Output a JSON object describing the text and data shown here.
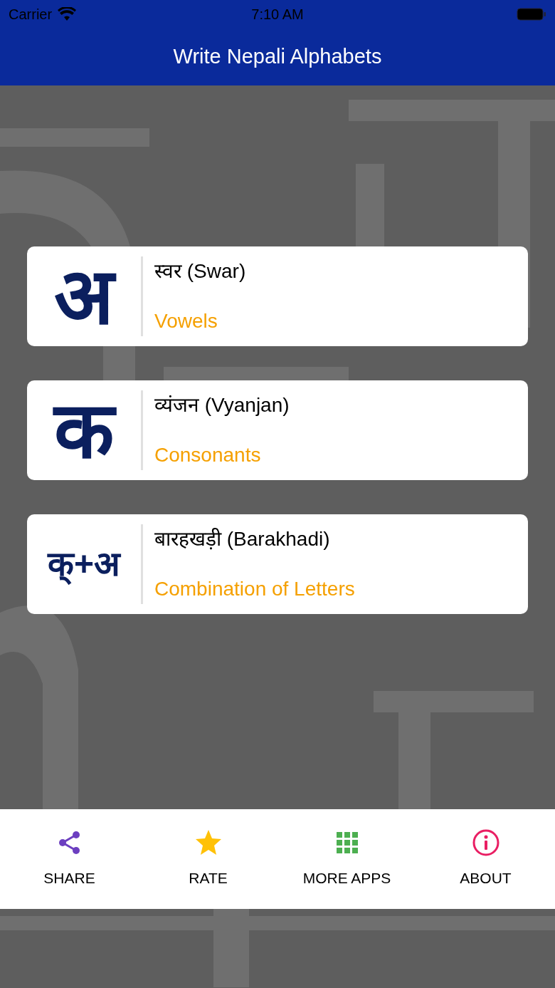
{
  "status_bar": {
    "carrier": "Carrier",
    "time": "7:10 AM"
  },
  "nav_bar": {
    "title": "Write Nepali Alphabets"
  },
  "menu": [
    {
      "glyph": "अ",
      "title": "स्वर (Swar)",
      "subtitle": "Vowels"
    },
    {
      "glyph": "क",
      "title": "व्यंजन (Vyanjan)",
      "subtitle": "Consonants"
    },
    {
      "glyph": "क्+अ",
      "title": "बारहखड़ी (Barakhadi)",
      "subtitle": "Combination of Letters"
    }
  ],
  "bottom_bar": [
    {
      "kind": "share",
      "label": "SHARE",
      "color": "#6c3fc0"
    },
    {
      "kind": "rate",
      "label": "RATE",
      "color": "#ffc107"
    },
    {
      "kind": "apps",
      "label": "MORE APPS",
      "color": "#4caf50"
    },
    {
      "kind": "about",
      "label": "ABOUT",
      "color": "#e91e63"
    }
  ]
}
